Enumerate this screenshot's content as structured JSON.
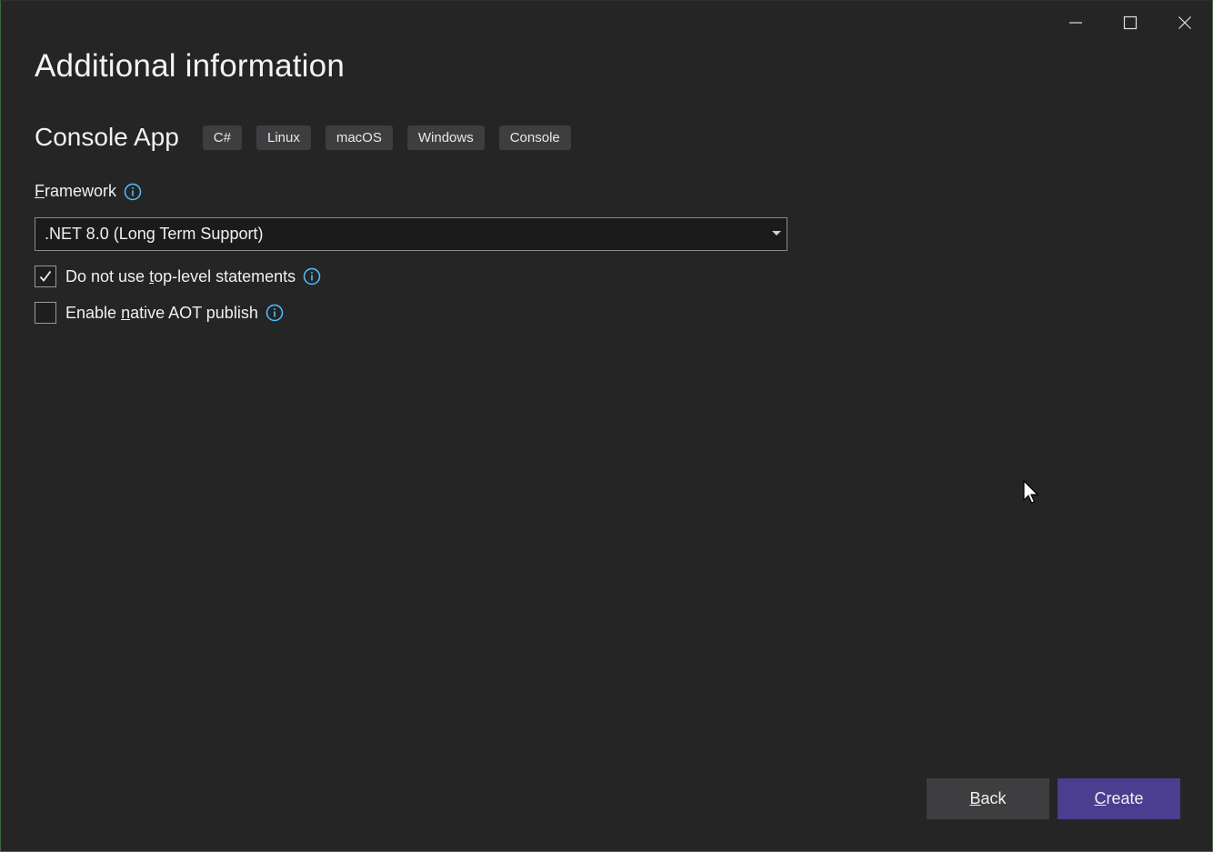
{
  "window": {
    "title": "Additional information",
    "controls": {
      "minimize": "minimize-icon",
      "maximize": "maximize-icon",
      "close": "close-icon"
    }
  },
  "project": {
    "name": "Console App",
    "tags": [
      "C#",
      "Linux",
      "macOS",
      "Windows",
      "Console"
    ]
  },
  "framework": {
    "label_prefix": "",
    "label_mnemonic": "F",
    "label_rest": "ramework",
    "selected": ".NET 8.0 (Long Term Support)"
  },
  "options": {
    "top_level": {
      "before": "Do not use ",
      "mnemonic": "t",
      "after": "op-level statements",
      "checked": true
    },
    "aot": {
      "before": "Enable ",
      "mnemonic": "n",
      "after": "ative AOT publish",
      "checked": false
    }
  },
  "buttons": {
    "back": {
      "mnemonic": "B",
      "rest": "ack"
    },
    "create": {
      "mnemonic": "C",
      "rest": "reate"
    }
  },
  "colors": {
    "accent": "#4b3d8f",
    "info": "#4fc1ff",
    "background": "#252526"
  }
}
